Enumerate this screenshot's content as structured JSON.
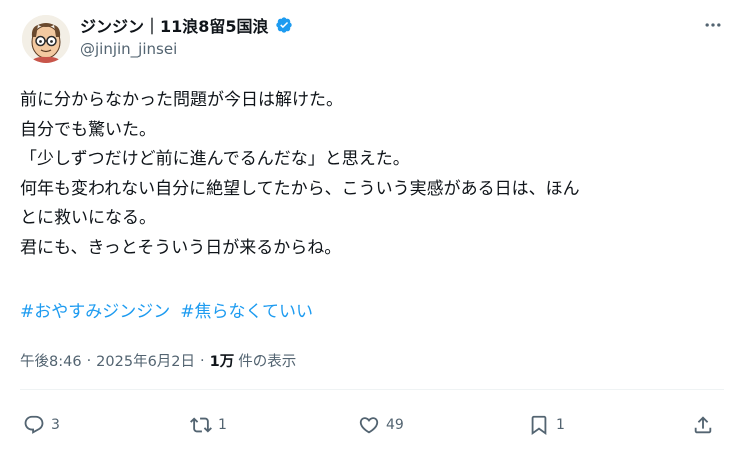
{
  "author": {
    "display_name": "ジンジン｜11浪8留5国浪",
    "handle": "@jinjin_jinsei",
    "verified": true,
    "avatar_icon": "cartoon-man-glasses-avatar"
  },
  "tweet": {
    "lines": [
      "前に分からなかった問題が今日は解けた。",
      "自分でも驚いた。",
      "「少しずつだけど前に進んでるんだな」と思えた。",
      "何年も変われない自分に絶望してたから、こういう実感がある日は、ほん",
      "とに救いになる。",
      "君にも、きっとそういう日が来るからね。"
    ],
    "hashtags": [
      "#おやすみジンジン",
      "#焦らなくていい"
    ]
  },
  "meta": {
    "time": "午後8:46",
    "date": "2025年6月2日",
    "views_count": "1万",
    "views_label": "件の表示"
  },
  "actions": {
    "replies": "3",
    "retweets": "1",
    "likes": "49",
    "bookmarks": "1"
  },
  "colors": {
    "accent": "#1d9bf0",
    "text": "#0f1419",
    "secondary": "#536471"
  }
}
